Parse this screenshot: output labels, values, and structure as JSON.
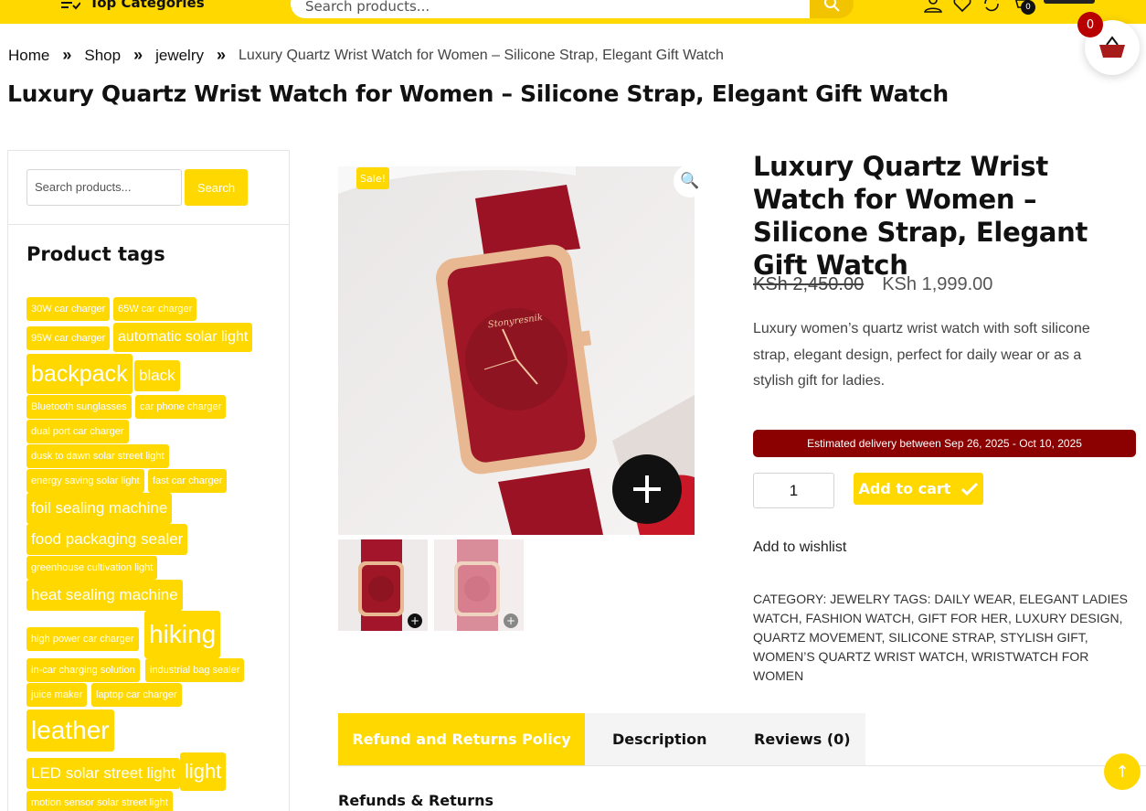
{
  "header": {
    "top_categories": "Top Categories",
    "search_placeholder": "Search products...",
    "cart_count": "0"
  },
  "floating_cart": {
    "count": "0"
  },
  "breadcrumb": {
    "home": "Home",
    "shop": "Shop",
    "category": "jewelry",
    "current": "Luxury Quartz Wrist Watch for Women – Silicone Strap, Elegant Gift Watch"
  },
  "page_title": "Luxury Quartz Wrist Watch for Women – Silicone Strap, Elegant Gift Watch",
  "sidebar": {
    "search_placeholder": "Search products...",
    "search_button": "Search",
    "tags_title": "Product tags",
    "tags": [
      "30W car charger",
      "65W car charger",
      "95W car charger",
      "automatic solar light",
      "backpack",
      "black",
      "Bluetooth sunglasses",
      "car phone charger",
      "dual port car charger",
      "dusk to dawn solar street light",
      "energy saving solar light",
      "fast car charger",
      "foil sealing machine",
      "food packaging sealer",
      "greenhouse cultivation light",
      "heat sealing machine",
      "high power car charger",
      "hiking",
      "in-car charging solution",
      "industrial bag sealer",
      "juice maker",
      "laptop car charger",
      "leather",
      "LED solar street light",
      "light",
      "motion sensor solar street light"
    ]
  },
  "gallery": {
    "sale_badge": "Sale!",
    "watch_brand": "Stonyresnik"
  },
  "product": {
    "title": "Luxury Quartz Wrist Watch for Women – Silicone Strap, Elegant Gift Watch",
    "old_price": "KSh 2,450.00",
    "new_price": "KSh 1,999.00",
    "short_description": "Luxury women’s quartz wrist watch with soft silicone strap, elegant design, perfect for daily wear or as a stylish gift for ladies.",
    "delivery": "Estimated delivery between Sep 26, 2025 - Oct 10, 2025",
    "quantity": "1",
    "add_to_cart": "Add to cart",
    "wishlist": "Add to wishlist",
    "meta": "Category: Jewelry Tags: Daily Wear, Elegant Ladies Watch, Fashion Watch, Gift For Her, Luxury Design, Quartz Movement, Silicone Strap, Stylish Gift, Women’s Quartz Wrist Watch, Wristwatch For Women"
  },
  "tabs": {
    "refund": "Refund and Returns Policy",
    "description": "Description",
    "reviews": "Reviews (0)"
  },
  "refunds_heading": "Refunds & Returns",
  "colors": {
    "accent": "#ffd800",
    "delivery_bg": "#8b0000",
    "watch_red": "#a3152a"
  }
}
